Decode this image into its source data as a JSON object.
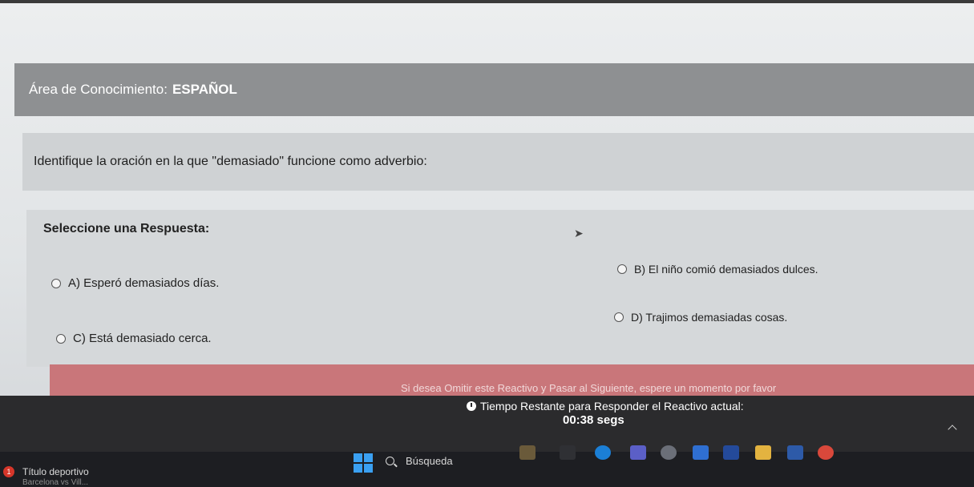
{
  "area": {
    "label": "Área de Conocimiento:",
    "value": "ESPAÑOL"
  },
  "question": {
    "text": "Identifique la oración en la que \"demasiado\" funcione como adverbio:"
  },
  "answers": {
    "title": "Seleccione una Respuesta:",
    "options": [
      {
        "label": "A) Esperó demasiados días."
      },
      {
        "label": "B) El niño comió demasiados dulces."
      },
      {
        "label": "C) Está demasiado cerca."
      },
      {
        "label": "D) Trajimos demasiadas cosas."
      }
    ]
  },
  "skip": {
    "text": "Si desea Omitir este Reactivo y Pasar al Siguiente, espere un momento por favor"
  },
  "timer": {
    "label": "Tiempo Restante para Responder el Reactivo actual:",
    "value": "00:38 segs"
  },
  "taskbar": {
    "search_placeholder": "Búsqueda",
    "news_badge": "1",
    "news_title": "Título deportivo",
    "news_subtitle": "Barcelona vs Vill..."
  },
  "colors": {
    "header_bg": "#8e9092",
    "question_bg": "#cfd2d4",
    "answer_bg": "#d5d8da",
    "skip_bg": "#c9767a",
    "timer_bg": "#2b2b2d",
    "taskbar_bg": "#1d1e22"
  },
  "icons": [
    "clock-icon",
    "windows-start-icon",
    "search-icon",
    "cursor-icon",
    "chevron-up-icon"
  ]
}
